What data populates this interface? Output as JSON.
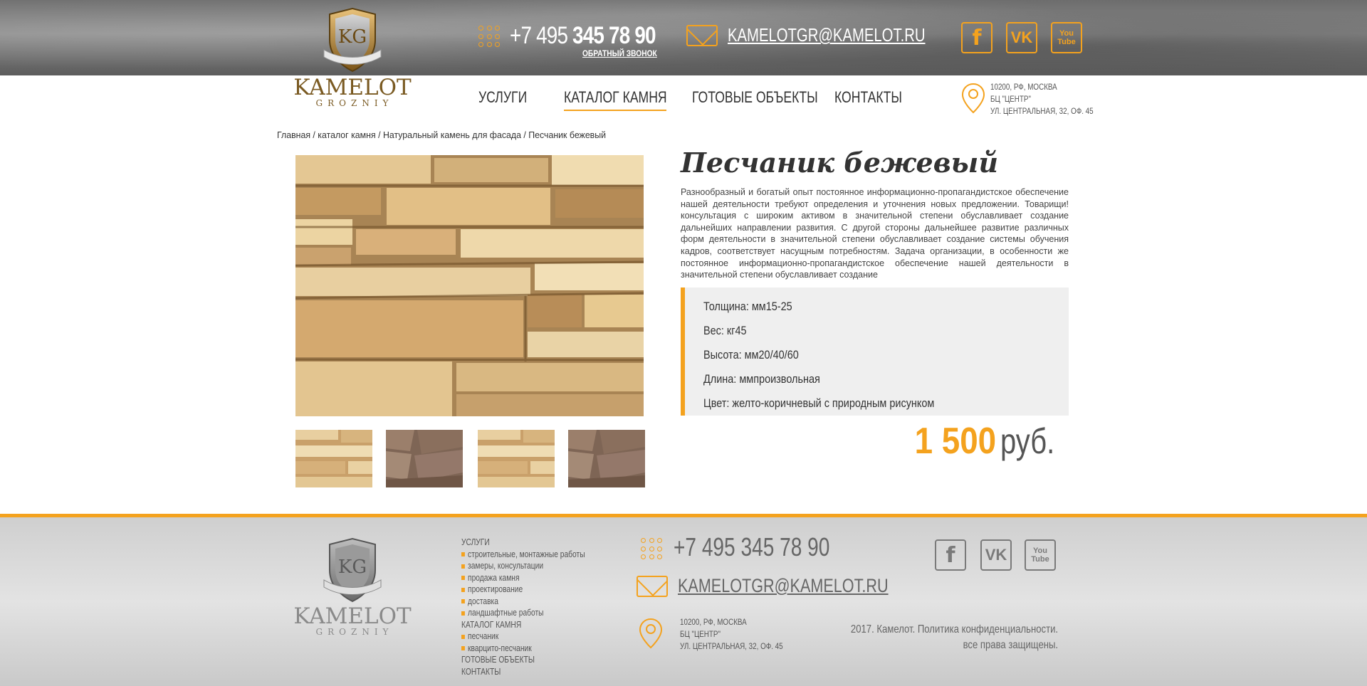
{
  "header": {
    "logo": {
      "monogram": "KG",
      "brand": "KAMELOT",
      "sub": "GROZNIY"
    },
    "phone": {
      "prefix": "+7 495 ",
      "main": "345 78 90"
    },
    "callback": "ОБРАТНЫЙ ЗВОНОК",
    "email": "KAMELOTGR@KAMELOT.RU",
    "social": {
      "fb": "f",
      "vk": "VK",
      "yt_top": "You",
      "yt_bottom": "Tube"
    }
  },
  "nav": {
    "items": [
      "УСЛУГИ",
      "КАТАЛОГ КАМНЯ",
      "ГОТОВЫЕ ОБЪЕКТЫ",
      "КОНТАКТЫ"
    ],
    "active_index": 1
  },
  "address": {
    "line1": "10200, РФ, МОСКВА",
    "line2": "БЦ \"ЦЕНТР\"",
    "line3": "УЛ. ЦЕНТРАЛЬНАЯ, 32, ОФ. 45"
  },
  "breadcrumb": "Главная / каталог камня / Натуральный камень для фасада / Песчаник бежевый",
  "product": {
    "title": "Песчаник бежевый",
    "description": "Разнообразный и богатый опыт постоянное информационно-пропагандистское обеспечение нашей деятельности требуют определения и уточнения новых предложении. Товарищи! консультация с широким активом в значительной степени обуславливает создание дальнейших направлении развития. С другой стороны дальнейшее развитие различных форм деятельности в значительной степени обуславливает создание системы обучения кадров, соответствует насущным потребностям. Задача организации, в особенности же постоянное информационно-пропагандистское обеспечение нашей деятельности в значительной степени обуславливает создание",
    "specs": [
      "Толщина: мм15-25",
      "Вес: кг45",
      "Высота: мм20/40/60",
      "Длина: ммпроизвольная",
      "Цвет: желто-коричневый с природным рисунком"
    ],
    "price_value": "1 500",
    "price_currency": "руб.",
    "thumbnails": [
      "beige",
      "brown",
      "beige",
      "brown"
    ]
  },
  "footer": {
    "logo": {
      "monogram": "KG",
      "brand": "KAMELOT",
      "sub": "GROZNIY"
    },
    "menu": [
      {
        "label": "УСЛУГИ",
        "sub": false
      },
      {
        "label": "строительные, монтажные работы",
        "sub": true
      },
      {
        "label": "замеры, консультации",
        "sub": true
      },
      {
        "label": "продажа камня",
        "sub": true
      },
      {
        "label": "проектирование",
        "sub": true
      },
      {
        "label": "доставка",
        "sub": true
      },
      {
        "label": "ландшафтные работы",
        "sub": true
      },
      {
        "label": "КАТАЛОГ КАМНЯ",
        "sub": false
      },
      {
        "label": "песчаник",
        "sub": true
      },
      {
        "label": "кварцито-песчаник",
        "sub": true
      },
      {
        "label": "ГОТОВЫЕ ОБЪЕКТЫ",
        "sub": false
      },
      {
        "label": "КОНТАКТЫ",
        "sub": false
      }
    ],
    "phone": "+7 495 345 78 90",
    "email": "KAMELOTGR@KAMELOT.RU",
    "address": {
      "line1": "10200, РФ, МОСКВА",
      "line2": "БЦ \"ЦЕНТР\"",
      "line3": "УЛ. ЦЕНТРАЛЬНАЯ, 32, ОФ. 45"
    },
    "copyright_line1": "2017. Камелот. Политика конфиденциальности.",
    "copyright_line2": "все права защищены."
  },
  "colors": {
    "accent": "#f4a21e",
    "stone_beige": "#d9b57d",
    "stone_brown": "#8e7461"
  }
}
